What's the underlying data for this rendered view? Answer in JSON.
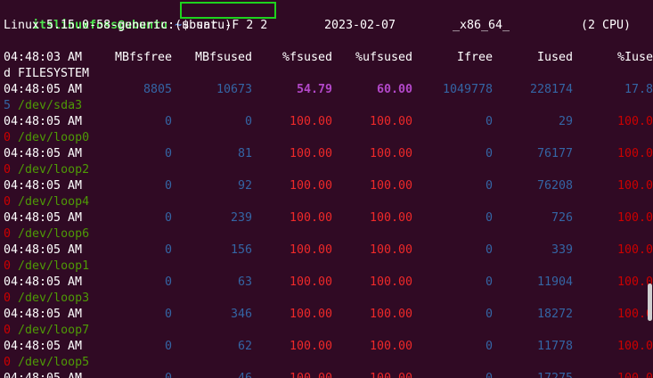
{
  "prompt": {
    "user_host": "itslinuxfoss@ubuntu",
    "sep": ":",
    "path": "~",
    "dollar": "$",
    "command": "sar -F 2 2"
  },
  "top_fragment": "  ]  [                          ]  ]        ]  ]  [          ]     ]  ]",
  "system_line": {
    "kernel": "Linux 5.15.0-58-generic (ubuntu)",
    "date": "2023-02-07",
    "arch": "_x86_64_",
    "cpus": "(2 CPU)"
  },
  "header": {
    "time": "04:48:03 AM",
    "mbfsfree": "MBfsfree",
    "mbfsused": "MBfsused",
    "fsused": "%fsused",
    "ufsused": "%ufsused",
    "ifree": "Ifree",
    "iused": "Iused",
    "iuse_part": "%Iuse",
    "wrap": "d FILESYSTEM"
  },
  "rows": [
    {
      "time": "04:48:05 AM",
      "free": "8805",
      "used": "10673",
      "fs": "54.79",
      "ufs": "60.00",
      "ifree": "1049778",
      "iused": "228174",
      "iuse": "17.8",
      "wrap_num": "5",
      "dev": "/dev/sda3",
      "highlight": true
    },
    {
      "time": "04:48:05 AM",
      "free": "0",
      "used": "0",
      "fs": "100.00",
      "ufs": "100.00",
      "ifree": "0",
      "iused": "29",
      "iuse": "100.0",
      "wrap_num": "0",
      "dev": "/dev/loop0",
      "highlight": false
    },
    {
      "time": "04:48:05 AM",
      "free": "0",
      "used": "81",
      "fs": "100.00",
      "ufs": "100.00",
      "ifree": "0",
      "iused": "76177",
      "iuse": "100.0",
      "wrap_num": "0",
      "dev": "/dev/loop2",
      "highlight": false
    },
    {
      "time": "04:48:05 AM",
      "free": "0",
      "used": "92",
      "fs": "100.00",
      "ufs": "100.00",
      "ifree": "0",
      "iused": "76208",
      "iuse": "100.0",
      "wrap_num": "0",
      "dev": "/dev/loop4",
      "highlight": false
    },
    {
      "time": "04:48:05 AM",
      "free": "0",
      "used": "239",
      "fs": "100.00",
      "ufs": "100.00",
      "ifree": "0",
      "iused": "726",
      "iuse": "100.0",
      "wrap_num": "0",
      "dev": "/dev/loop6",
      "highlight": false
    },
    {
      "time": "04:48:05 AM",
      "free": "0",
      "used": "156",
      "fs": "100.00",
      "ufs": "100.00",
      "ifree": "0",
      "iused": "339",
      "iuse": "100.0",
      "wrap_num": "0",
      "dev": "/dev/loop1",
      "highlight": false
    },
    {
      "time": "04:48:05 AM",
      "free": "0",
      "used": "63",
      "fs": "100.00",
      "ufs": "100.00",
      "ifree": "0",
      "iused": "11904",
      "iuse": "100.0",
      "wrap_num": "0",
      "dev": "/dev/loop3",
      "highlight": false
    },
    {
      "time": "04:48:05 AM",
      "free": "0",
      "used": "346",
      "fs": "100.00",
      "ufs": "100.00",
      "ifree": "0",
      "iused": "18272",
      "iuse": "100.0",
      "wrap_num": "0",
      "dev": "/dev/loop7",
      "highlight": false
    },
    {
      "time": "04:48:05 AM",
      "free": "0",
      "used": "62",
      "fs": "100.00",
      "ufs": "100.00",
      "ifree": "0",
      "iused": "11778",
      "iuse": "100.0",
      "wrap_num": "0",
      "dev": "/dev/loop5",
      "highlight": false
    },
    {
      "time": "04:48:05 AM",
      "free": "0",
      "used": "46",
      "fs": "100.00",
      "ufs": "100.00",
      "ifree": "0",
      "iused": "17275",
      "iuse": "100.0",
      "wrap_num": "",
      "dev": "",
      "highlight": false
    }
  ],
  "colors": {
    "background": "#300a24",
    "prompt_user": "#4ee34e",
    "prompt_path": "#5b8dd9",
    "numbers": "#3465a4",
    "percent_highlight": "#b348c9",
    "percent_full": "#ef2929",
    "device": "#4e9a06",
    "command_box": "#1ed31e"
  }
}
